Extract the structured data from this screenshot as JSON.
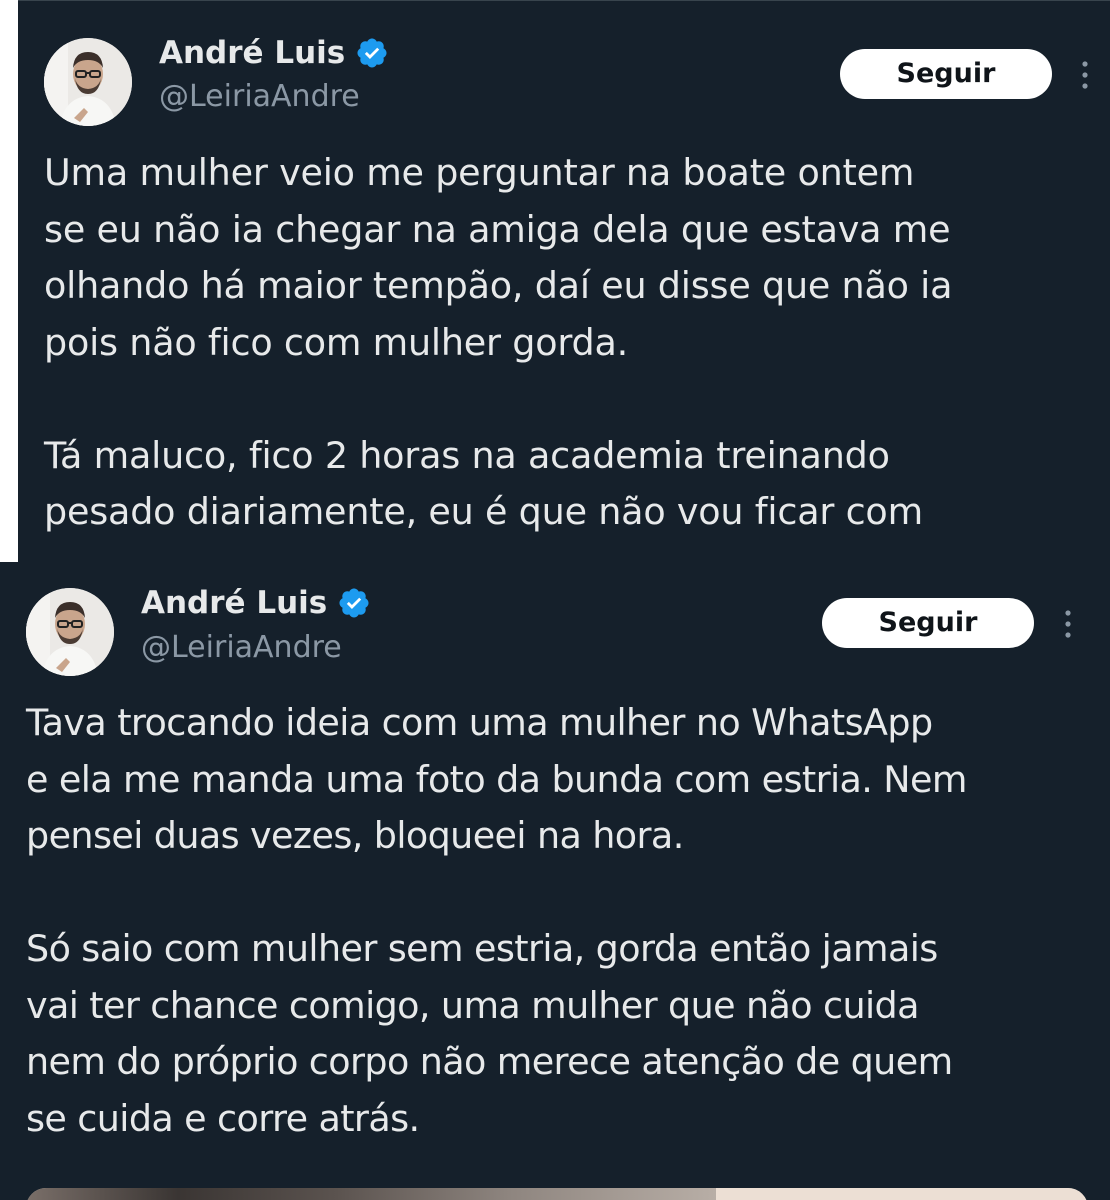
{
  "tweets": [
    {
      "author_name": "André Luis",
      "verified": true,
      "handle": "@LeiriaAndre",
      "follow_label": "Seguir",
      "text": "Uma mulher veio me perguntar na boate ontem\nse eu não ia chegar na amiga dela que estava me\nolhando há maior tempão, daí eu disse que não ia\npois não fico com mulher gorda.\n\nTá maluco, fico 2 horas na academia treinando\npesado diariamente, eu é que não vou ficar com"
    },
    {
      "author_name": "André Luis",
      "verified": true,
      "handle": "@LeiriaAndre",
      "follow_label": "Seguir",
      "text": "Tava trocando ideia com uma mulher no WhatsApp\ne ela me manda uma foto da bunda com estria. Nem\npensei duas vezes, bloqueei na hora.\n\nSó saio com mulher sem estria, gorda então jamais\nvai ter chance comigo, uma mulher que não cuida\nnem do próprio corpo não merece atenção de quem\nse cuida e corre atrás."
    }
  ],
  "colors": {
    "background": "#15202b",
    "text_primary": "#e7e9ea",
    "text_secondary": "#8b98a5",
    "verified_badge": "#1d9bf0",
    "follow_button_bg": "#ffffff",
    "follow_button_text": "#0f1419"
  },
  "icons": {
    "verified": "verified-badge-icon",
    "more": "more-options-icon"
  }
}
